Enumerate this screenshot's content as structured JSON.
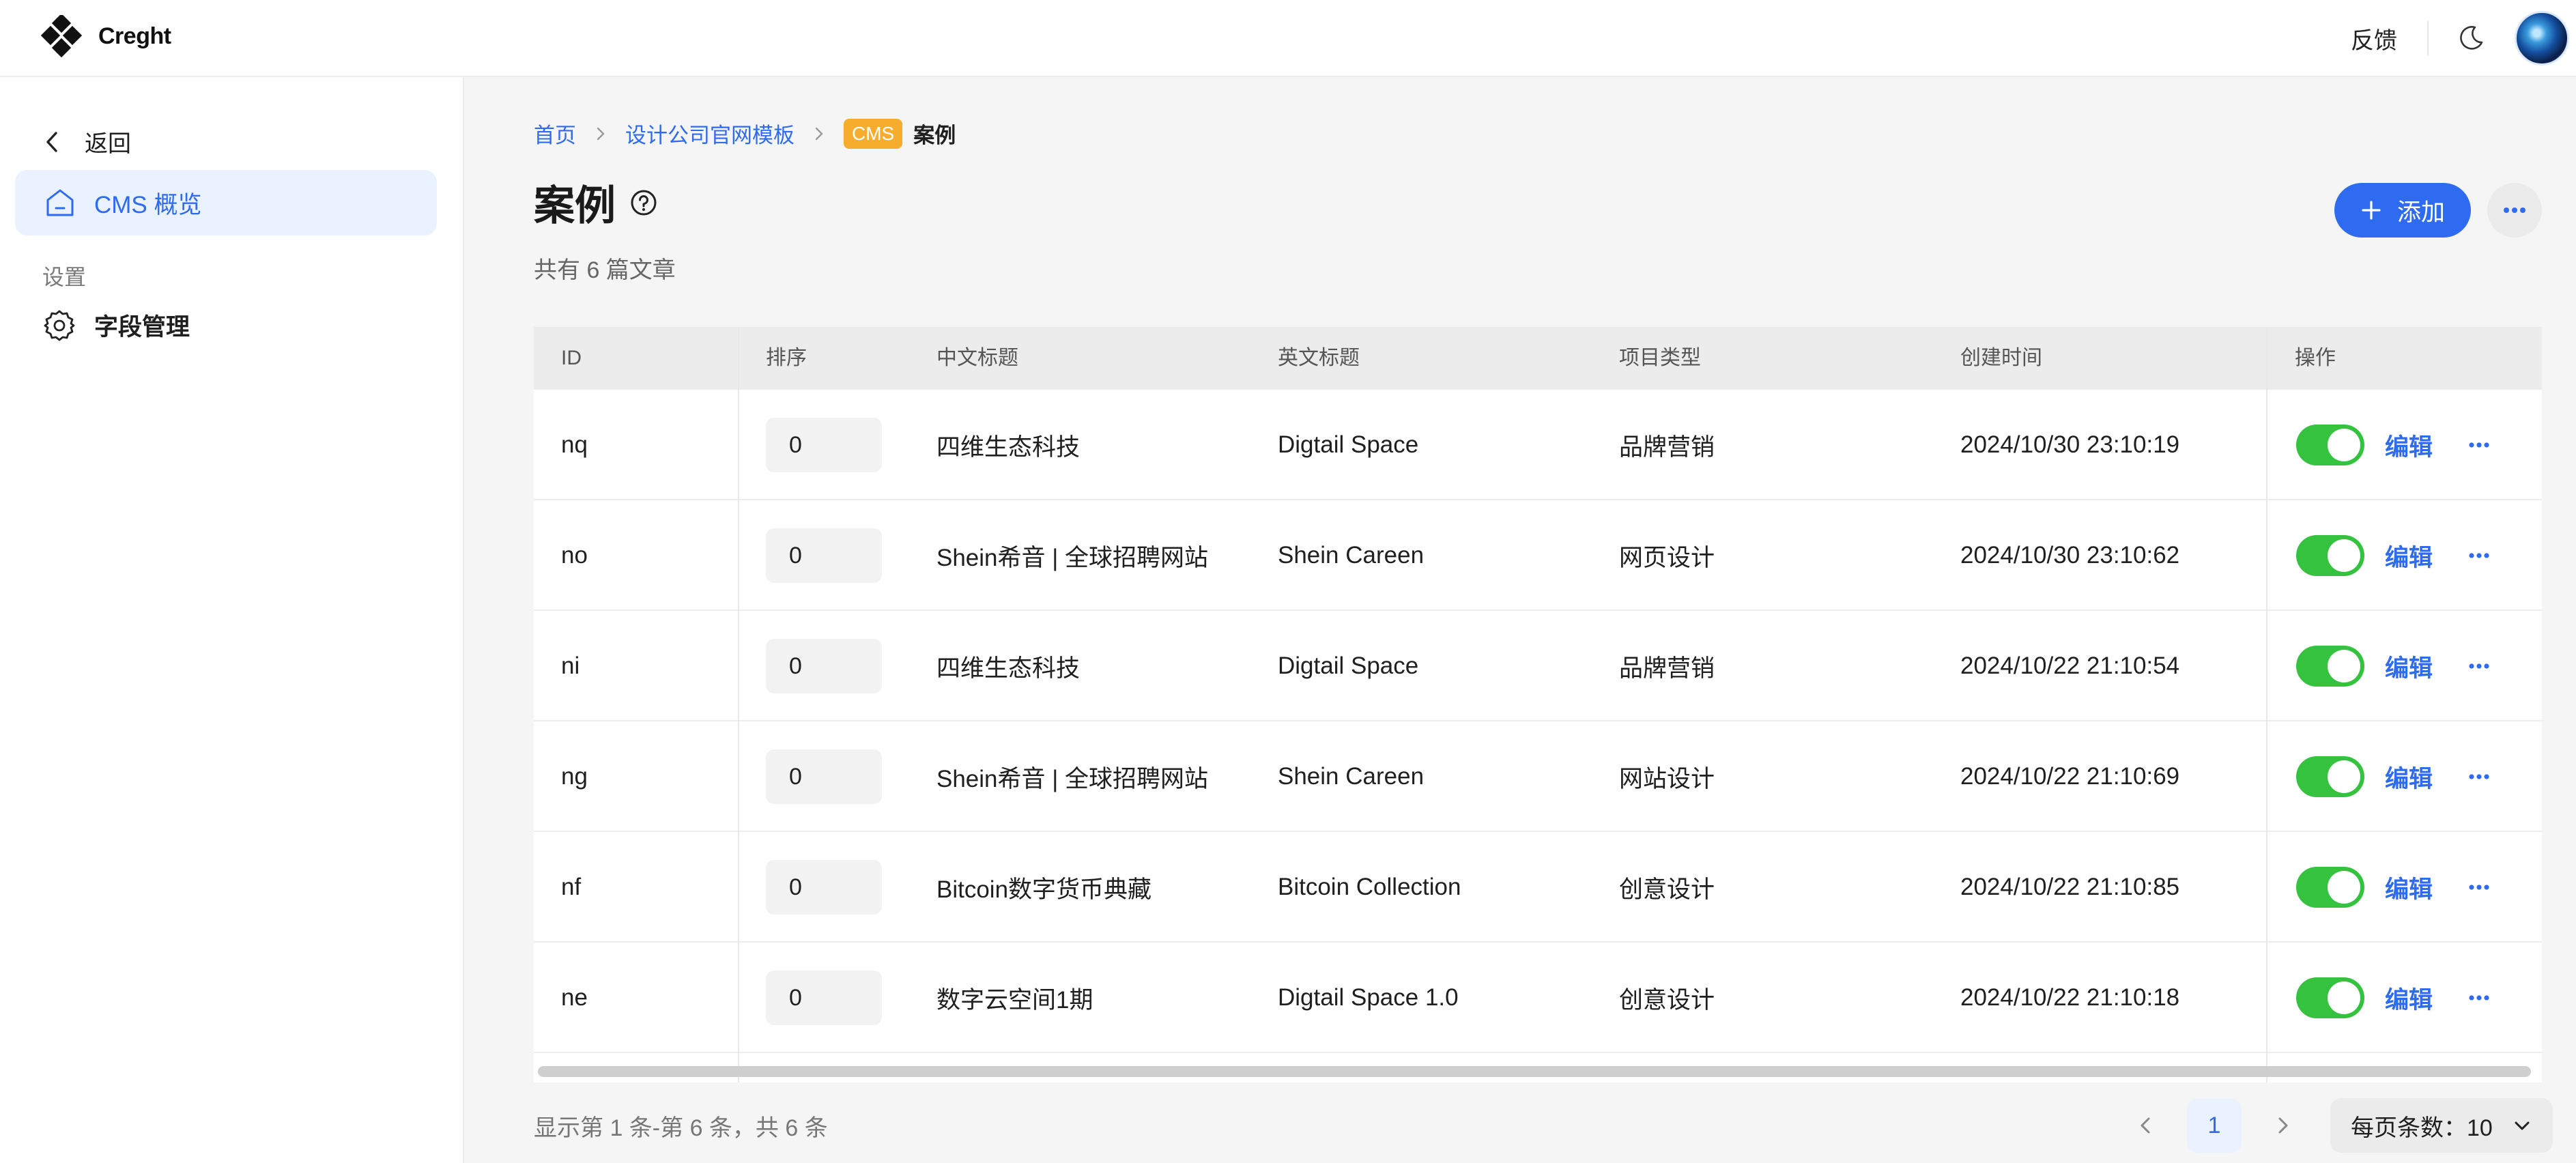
{
  "app": {
    "name": "Creght"
  },
  "topbar": {
    "feedback_label": "反馈"
  },
  "sidebar": {
    "back_label": "返回",
    "active_item": "CMS 概览",
    "section_label": "设置",
    "items": [
      {
        "label": "字段管理"
      }
    ]
  },
  "breadcrumb": {
    "home": "首页",
    "template": "设计公司官网模板",
    "tag": "CMS",
    "current": "案例"
  },
  "page": {
    "title": "案例",
    "subtitle": "共有 6 篇文章",
    "add_label": "添加"
  },
  "table": {
    "headers": {
      "id": "ID",
      "sort": "排序",
      "title_cn": "中文标题",
      "title_en": "英文标题",
      "type": "项目类型",
      "created": "创建时间",
      "ops": "操作"
    },
    "edit_label": "编辑",
    "rows": [
      {
        "id": "nq",
        "sort": "0",
        "title_cn": "四维生态科技",
        "title_en": "Digtail Space",
        "type": "品牌营销",
        "created": "2024/10/30 23:10:19",
        "enabled": true
      },
      {
        "id": "no",
        "sort": "0",
        "title_cn": "Shein希音 | 全球招聘网站",
        "title_en": "Shein Careen",
        "type": "网页设计",
        "created": "2024/10/30 23:10:62",
        "enabled": true
      },
      {
        "id": "ni",
        "sort": "0",
        "title_cn": "四维生态科技",
        "title_en": "Digtail Space",
        "type": "品牌营销",
        "created": "2024/10/22 21:10:54",
        "enabled": true
      },
      {
        "id": "ng",
        "sort": "0",
        "title_cn": "Shein希音 | 全球招聘网站",
        "title_en": "Shein Careen",
        "type": "网站设计",
        "created": "2024/10/22 21:10:69",
        "enabled": true
      },
      {
        "id": "nf",
        "sort": "0",
        "title_cn": "Bitcoin数字货币典藏",
        "title_en": "Bitcoin Collection",
        "type": "创意设计",
        "created": "2024/10/22 21:10:85",
        "enabled": true
      },
      {
        "id": "ne",
        "sort": "0",
        "title_cn": "数字云空间1期",
        "title_en": "Digtail Space 1.0",
        "type": "创意设计",
        "created": "2024/10/22 21:10:18",
        "enabled": true
      }
    ]
  },
  "pagination": {
    "summary": "显示第 1 条-第 6 条，共 6 条",
    "current_page": "1",
    "page_size_label": "每页条数：10"
  },
  "colors": {
    "accent": "#2f6bf0",
    "toggle_on": "#35c23f",
    "cms_tag": "#f6ad2e"
  }
}
